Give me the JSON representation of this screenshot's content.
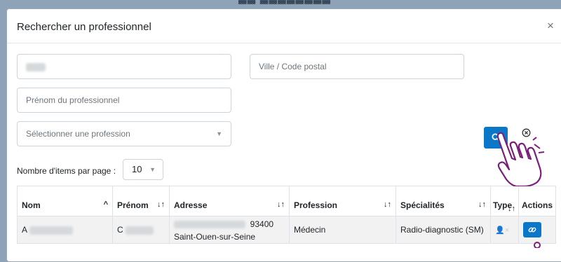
{
  "modal": {
    "title": "Rechercher un professionnel",
    "close_label": "×"
  },
  "form": {
    "city_placeholder": "Ville / Code postal",
    "firstname_placeholder": "Prénom du professionnel",
    "profession_placeholder": "Sélectionner une profession"
  },
  "pagination": {
    "label": "Nombre d'items par page :",
    "value": "10"
  },
  "table": {
    "headers": {
      "nom": "Nom",
      "prenom": "Prénom",
      "adresse": "Adresse",
      "profession": "Profession",
      "specialites": "Spécialités",
      "type": "Type",
      "actions": "Actions"
    },
    "sort_icons": {
      "asc": "^",
      "sortable": "↓↑"
    },
    "rows": [
      {
        "nom_initial": "A",
        "prenom_initial": "C",
        "postal_code": "93400",
        "city": "Saint-Ouen-sur-Seine",
        "profession": "Médecin",
        "specialite": "Radio-diagnostic (SM)"
      }
    ]
  }
}
